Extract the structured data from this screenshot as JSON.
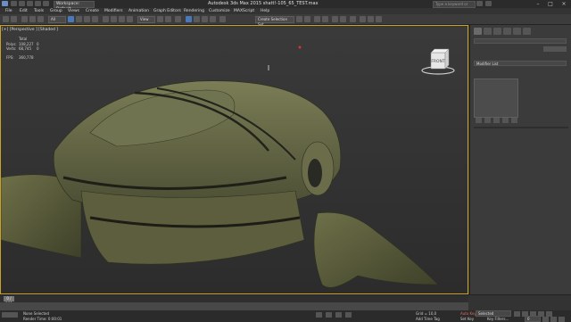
{
  "titlebar": {
    "workspace": "Workspace: Default",
    "title": "Autodesk 3ds Max  2015      shatt!-105_65_TEST.max",
    "search_placeholder": "Type a keyword or phrase"
  },
  "menus": [
    "File",
    "Edit",
    "Tools",
    "Group",
    "Views",
    "Create",
    "Modifiers",
    "Animation",
    "Graph Editors",
    "Rendering",
    "Customize",
    "MAXScript",
    "Help"
  ],
  "toolbar": {
    "selection_filter": "All",
    "view_dropdown": "View",
    "named_selection_sets": "Create Selection Set"
  },
  "viewport": {
    "label": "[+] [Perspective ] [Shaded ]",
    "stats": {
      "total_label": "Total",
      "polys_label": "Polys:",
      "polys_value": "108,227",
      "polys_sel": "0",
      "verts_label": "Verts:",
      "verts_value": "68,745",
      "verts_sel": "0",
      "fps_label": "FPS:",
      "fps_value": "360,778"
    },
    "viewcube_face": "FRONT"
  },
  "command_panel": {
    "modifier_list": "Modifier List"
  },
  "timeline": {
    "frame_display": "0 / 100"
  },
  "status": {
    "selection": "None Selected",
    "render_time": "Render Time: 0:00:01",
    "grid": "Grid = 10,0",
    "auto_key": "Auto Key",
    "set_key": "Set Key",
    "selected_dropdown": "Selected",
    "key_filters": "Key Filters...",
    "add_time_tag": "Add Time Tag",
    "frame_field": "0"
  },
  "colors": {
    "viewport_border": "#c9a227",
    "accent_blue": "#4a78b8",
    "ship_green": "#5f6340",
    "auto_key_red": "#b43a2e"
  }
}
